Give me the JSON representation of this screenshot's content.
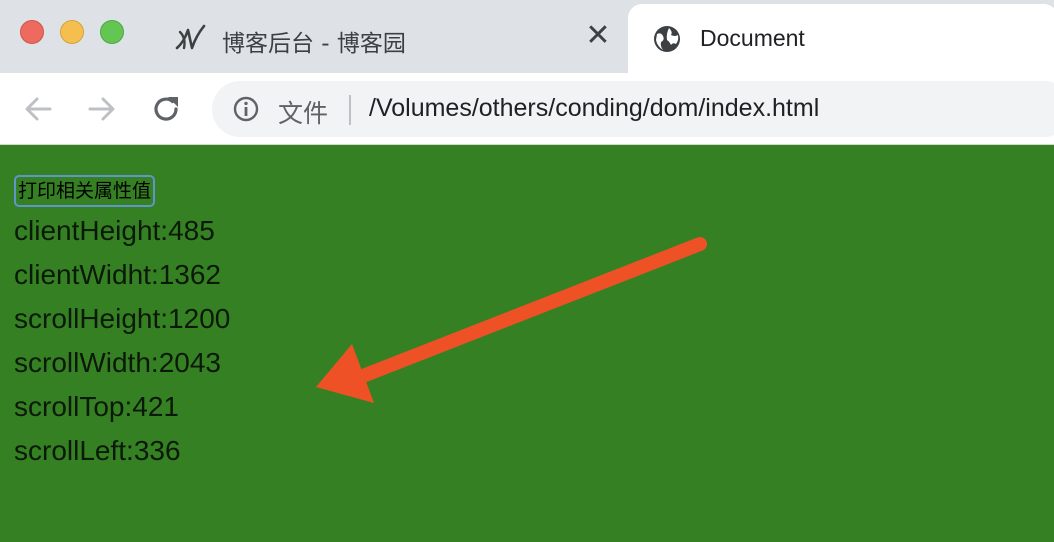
{
  "browser": {
    "tabs": [
      {
        "title": "博客后台 - 博客园",
        "favicon": "cnblogs-logo-icon",
        "close": "✕"
      },
      {
        "title": "Document",
        "favicon": "globe-icon"
      }
    ],
    "address": {
      "scheme_label": "文件",
      "url": "/Volumes/others/conding/dom/index.html"
    }
  },
  "page": {
    "background": "#368024",
    "button_label": "打印相关属性值",
    "properties": [
      "clientHeight:485",
      "clientWidht:1362",
      "scrollHeight:1200",
      "scrollWidth:2043",
      "scrollTop:421",
      "scrollLeft:336"
    ]
  },
  "annotation": {
    "arrow_color": "#ee5125"
  }
}
